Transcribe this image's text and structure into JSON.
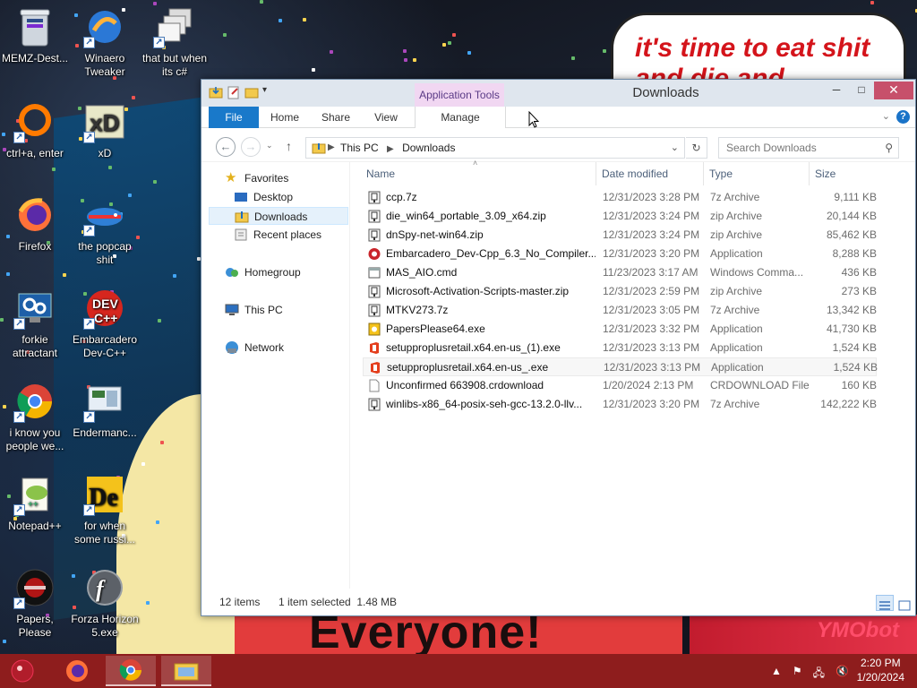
{
  "desktop": {
    "speech_text": "it's time to eat shit and die and celebrate",
    "banner_text": "Everyone!",
    "corner_deco_text": "YMObot",
    "icons": [
      {
        "label": "MEMZ-Dest...",
        "icon": "recycle-bin-icon"
      },
      {
        "label": "Winaero Tweaker",
        "icon": "winaero-icon"
      },
      {
        "label": "that but when its c#",
        "icon": "stacked-windows-icon"
      },
      {
        "label": "ctrl+a, enter",
        "icon": "orange-ring-icon"
      },
      {
        "label": "xD",
        "icon": "hxd-icon"
      },
      {
        "label": "Firefox",
        "icon": "firefox-icon"
      },
      {
        "label": "the popcap shit",
        "icon": "popcap-icon"
      },
      {
        "label": "forkie attractant",
        "icon": "gears-monitor-icon"
      },
      {
        "label": "Embarcadero Dev-C++",
        "icon": "devcpp-icon"
      },
      {
        "label": "i know you people we...",
        "icon": "chrome-icon"
      },
      {
        "label": "Endermanc...",
        "icon": "monitor-icon"
      },
      {
        "label": "Notepad++",
        "icon": "notepadpp-icon"
      },
      {
        "label": "for when some russi...",
        "icon": "de-icon"
      },
      {
        "label": "Papers, Please",
        "icon": "papers-please-icon"
      },
      {
        "label": "Forza Horizon 5.exe",
        "icon": "flash-icon"
      }
    ]
  },
  "window": {
    "title": "Downloads",
    "context_tab": "Application Tools",
    "ribbon_tabs": [
      "File",
      "Home",
      "Share",
      "View",
      "Manage"
    ],
    "address": {
      "crumbs": [
        "This PC",
        "Downloads"
      ]
    },
    "search_placeholder": "Search Downloads",
    "nav": {
      "favorites": "Favorites",
      "desktop": "Desktop",
      "downloads": "Downloads",
      "recent": "Recent places",
      "homegroup": "Homegroup",
      "thispc": "This PC",
      "network": "Network"
    },
    "columns": {
      "name": "Name",
      "date": "Date modified",
      "type": "Type",
      "size": "Size"
    },
    "files": [
      {
        "name": "ccp.7z",
        "date": "12/31/2023 3:28 PM",
        "type": "7z Archive",
        "size": "9,111 KB",
        "icon": "archive-icon"
      },
      {
        "name": "die_win64_portable_3.09_x64.zip",
        "date": "12/31/2023 3:24 PM",
        "type": "zip Archive",
        "size": "20,144 KB",
        "icon": "archive-icon"
      },
      {
        "name": "dnSpy-net-win64.zip",
        "date": "12/31/2023 3:24 PM",
        "type": "zip Archive",
        "size": "85,462 KB",
        "icon": "archive-icon"
      },
      {
        "name": "Embarcadero_Dev-Cpp_6.3_No_Compiler...",
        "date": "12/31/2023 3:20 PM",
        "type": "Application",
        "size": "8,288 KB",
        "icon": "devcpp-app-icon"
      },
      {
        "name": "MAS_AIO.cmd",
        "date": "11/23/2023 3:17 AM",
        "type": "Windows Comma...",
        "size": "436 KB",
        "icon": "cmd-icon"
      },
      {
        "name": "Microsoft-Activation-Scripts-master.zip",
        "date": "12/31/2023 2:59 PM",
        "type": "zip Archive",
        "size": "273 KB",
        "icon": "archive-icon"
      },
      {
        "name": "MTKV273.7z",
        "date": "12/31/2023 3:05 PM",
        "type": "7z Archive",
        "size": "13,342 KB",
        "icon": "archive-icon"
      },
      {
        "name": "PapersPlease64.exe",
        "date": "12/31/2023 3:32 PM",
        "type": "Application",
        "size": "41,730 KB",
        "icon": "exe-icon"
      },
      {
        "name": "setupproplusretail.x64.en-us_(1).exe",
        "date": "12/31/2023 3:13 PM",
        "type": "Application",
        "size": "1,524 KB",
        "icon": "office-icon"
      },
      {
        "name": "setupproplusretail.x64.en-us_.exe",
        "date": "12/31/2023 3:13 PM",
        "type": "Application",
        "size": "1,524 KB",
        "icon": "office-icon"
      },
      {
        "name": "Unconfirmed 663908.crdownload",
        "date": "1/20/2024 2:13 PM",
        "type": "CRDOWNLOAD File",
        "size": "160 KB",
        "icon": "blank-file-icon"
      },
      {
        "name": "winlibs-x86_64-posix-seh-gcc-13.2.0-llv...",
        "date": "12/31/2023 3:20 PM",
        "type": "7z Archive",
        "size": "142,222 KB",
        "icon": "archive-icon"
      }
    ],
    "selected_index": 9,
    "status": {
      "count": "12 items",
      "selection": "1 item selected  1.48 MB"
    }
  },
  "taskbar": {
    "apps": [
      "start-orb-icon",
      "firefox-icon",
      "chrome-icon",
      "file-explorer-icon"
    ],
    "clock_time": "2:20 PM",
    "clock_date": "1/20/2024"
  },
  "colors": {
    "taskbar": "#8e1d1d",
    "file_tab": "#1979ca",
    "context_tab": "#f1d7f2"
  }
}
